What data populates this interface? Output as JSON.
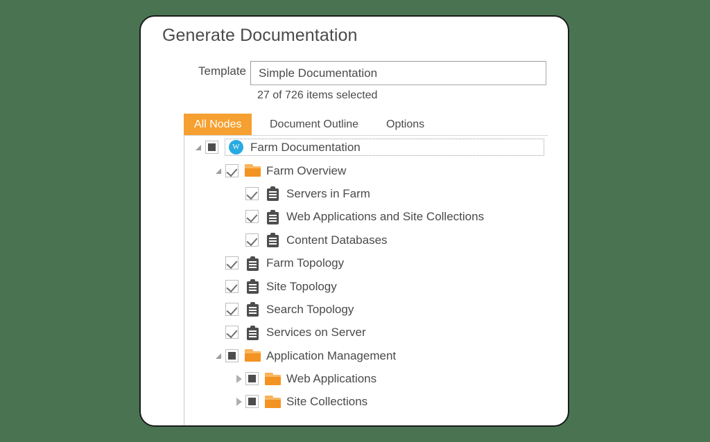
{
  "window": {
    "background_color": "#4a7352",
    "card_background": "#ffffff",
    "accent_color": "#f5a030"
  },
  "header": {
    "title": "Generate Documentation"
  },
  "template": {
    "label": "Template",
    "value": "Simple Documentation",
    "placeholder": "Simple Documentation"
  },
  "status": {
    "items_selected": "27 of 726 items selected",
    "selected_count": 27,
    "total_count": 726
  },
  "tabs": [
    {
      "label": "All Nodes",
      "active": true
    },
    {
      "label": "Document Outline",
      "active": false
    },
    {
      "label": "Options",
      "active": false
    }
  ],
  "tree": {
    "nodes": [
      {
        "label": "Farm Documentation",
        "depth": 0,
        "expander": "open",
        "check": "partial",
        "icon": "word-document-icon",
        "focused": true
      },
      {
        "label": "Farm Overview",
        "depth": 1,
        "expander": "open",
        "check": "checked",
        "icon": "folder-icon",
        "focused": false
      },
      {
        "label": "Servers in Farm",
        "depth": 2,
        "expander": "none",
        "check": "checked",
        "icon": "report-icon",
        "focused": false
      },
      {
        "label": "Web Applications and Site Collections",
        "depth": 2,
        "expander": "none",
        "check": "checked",
        "icon": "report-icon",
        "focused": false
      },
      {
        "label": "Content Databases",
        "depth": 2,
        "expander": "none",
        "check": "checked",
        "icon": "report-icon",
        "focused": false
      },
      {
        "label": "Farm Topology",
        "depth": 1,
        "expander": "none",
        "check": "checked",
        "icon": "report-icon",
        "focused": false
      },
      {
        "label": "Site Topology",
        "depth": 1,
        "expander": "none",
        "check": "checked",
        "icon": "report-icon",
        "focused": false
      },
      {
        "label": "Search Topology",
        "depth": 1,
        "expander": "none",
        "check": "checked",
        "icon": "report-icon",
        "focused": false
      },
      {
        "label": "Services on Server",
        "depth": 1,
        "expander": "none",
        "check": "checked",
        "icon": "report-icon",
        "focused": false
      },
      {
        "label": "Application Management",
        "depth": 1,
        "expander": "open",
        "check": "partial",
        "icon": "folder-icon",
        "focused": false
      },
      {
        "label": "Web Applications",
        "depth": 2,
        "expander": "closed",
        "check": "partial",
        "icon": "folder-icon",
        "focused": false
      },
      {
        "label": "Site Collections",
        "depth": 2,
        "expander": "closed",
        "check": "partial",
        "icon": "folder-icon",
        "focused": false
      }
    ],
    "word_icon_letter": "W"
  }
}
